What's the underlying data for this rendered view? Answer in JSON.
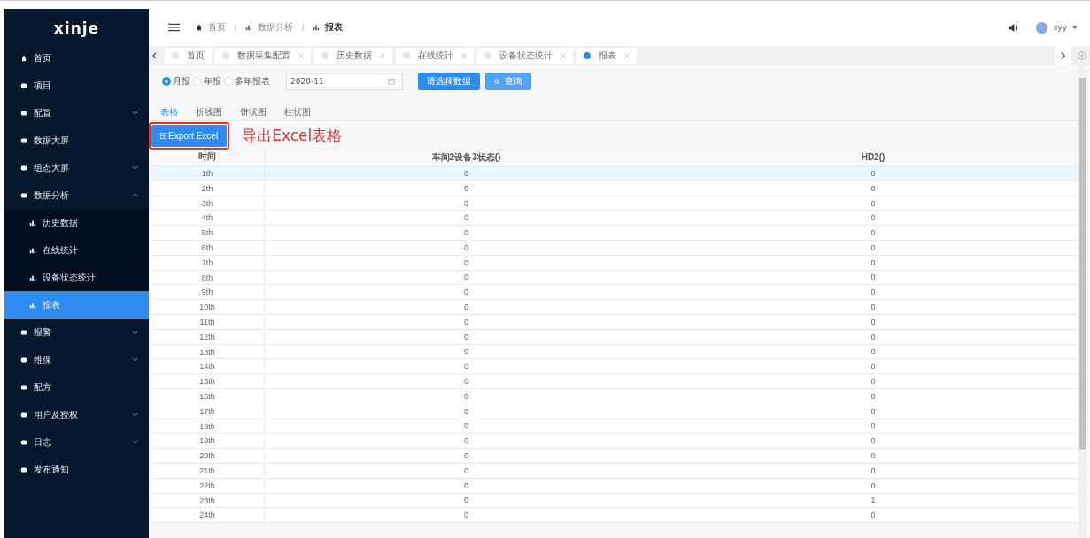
{
  "sidebar": {
    "logo": "xinje",
    "items": [
      {
        "label": "首页",
        "selected": false
      },
      {
        "label": "项目",
        "selected": false
      },
      {
        "label": "配置",
        "selected": false,
        "expanded": false
      },
      {
        "label": "数据大屏",
        "selected": false
      },
      {
        "label": "组态大屏",
        "selected": false,
        "expanded": false
      },
      {
        "label": "数据分析",
        "selected": false,
        "expanded": true,
        "children": [
          {
            "label": "历史数据",
            "selected": false
          },
          {
            "label": "在线统计",
            "selected": false
          },
          {
            "label": "设备状态统计",
            "selected": false
          },
          {
            "label": "报表",
            "selected": true
          }
        ]
      },
      {
        "label": "报警",
        "selected": false,
        "expanded": false
      },
      {
        "label": "维保",
        "selected": false,
        "expanded": false
      },
      {
        "label": "配方",
        "selected": false
      },
      {
        "label": "用户及授权",
        "selected": false,
        "expanded": false
      },
      {
        "label": "日志",
        "selected": false,
        "expanded": false
      },
      {
        "label": "发布通知",
        "selected": false
      }
    ]
  },
  "breadcrumb": [
    "首页",
    "数据分析",
    "报表"
  ],
  "user": {
    "name": "syy"
  },
  "tabs": [
    {
      "label": "首页",
      "selected": false,
      "closable": false
    },
    {
      "label": "数据采集配置",
      "selected": false,
      "closable": true
    },
    {
      "label": "历史数据",
      "selected": false,
      "closable": true
    },
    {
      "label": "在线统计",
      "selected": false,
      "closable": true
    },
    {
      "label": "设备状态统计",
      "selected": false,
      "closable": true
    },
    {
      "label": "报表",
      "selected": true,
      "closable": true
    }
  ],
  "report_types": [
    {
      "label": "月报",
      "selected": true
    },
    {
      "label": "年报",
      "selected": false
    },
    {
      "label": "多年报表",
      "selected": false
    }
  ],
  "date_field": {
    "value": "2020-11"
  },
  "select_button": "请选择数据",
  "query_button": "查询",
  "view_tabs": [
    {
      "label": "表格",
      "selected": true
    },
    {
      "label": "折线图",
      "selected": false
    },
    {
      "label": "饼状图",
      "selected": false
    },
    {
      "label": "柱状图",
      "selected": false
    }
  ],
  "export_button": "Export Excel",
  "annotation": "导出Excel表格",
  "table": {
    "columns": [
      "时间",
      "车间2设备3状态()",
      "HD2()"
    ],
    "rows": [
      [
        "1th",
        "0",
        "0"
      ],
      [
        "2th",
        "0",
        "0"
      ],
      [
        "3th",
        "0",
        "0"
      ],
      [
        "4th",
        "0",
        "0"
      ],
      [
        "5th",
        "0",
        "0"
      ],
      [
        "6th",
        "0",
        "0"
      ],
      [
        "7th",
        "0",
        "0"
      ],
      [
        "8th",
        "0",
        "0"
      ],
      [
        "9th",
        "0",
        "0"
      ],
      [
        "10th",
        "0",
        "0"
      ],
      [
        "11th",
        "0",
        "0"
      ],
      [
        "12th",
        "0",
        "0"
      ],
      [
        "13th",
        "0",
        "0"
      ],
      [
        "14th",
        "0",
        "0"
      ],
      [
        "15th",
        "0",
        "0"
      ],
      [
        "16th",
        "0",
        "0"
      ],
      [
        "17th",
        "0",
        "0"
      ],
      [
        "18th",
        "0",
        "0"
      ],
      [
        "19th",
        "0",
        "0"
      ],
      [
        "20th",
        "0",
        "0"
      ],
      [
        "21th",
        "0",
        "0"
      ],
      [
        "22th",
        "0",
        "0"
      ],
      [
        "23th",
        "0",
        "1"
      ],
      [
        "24th",
        "0",
        "0"
      ]
    ]
  }
}
